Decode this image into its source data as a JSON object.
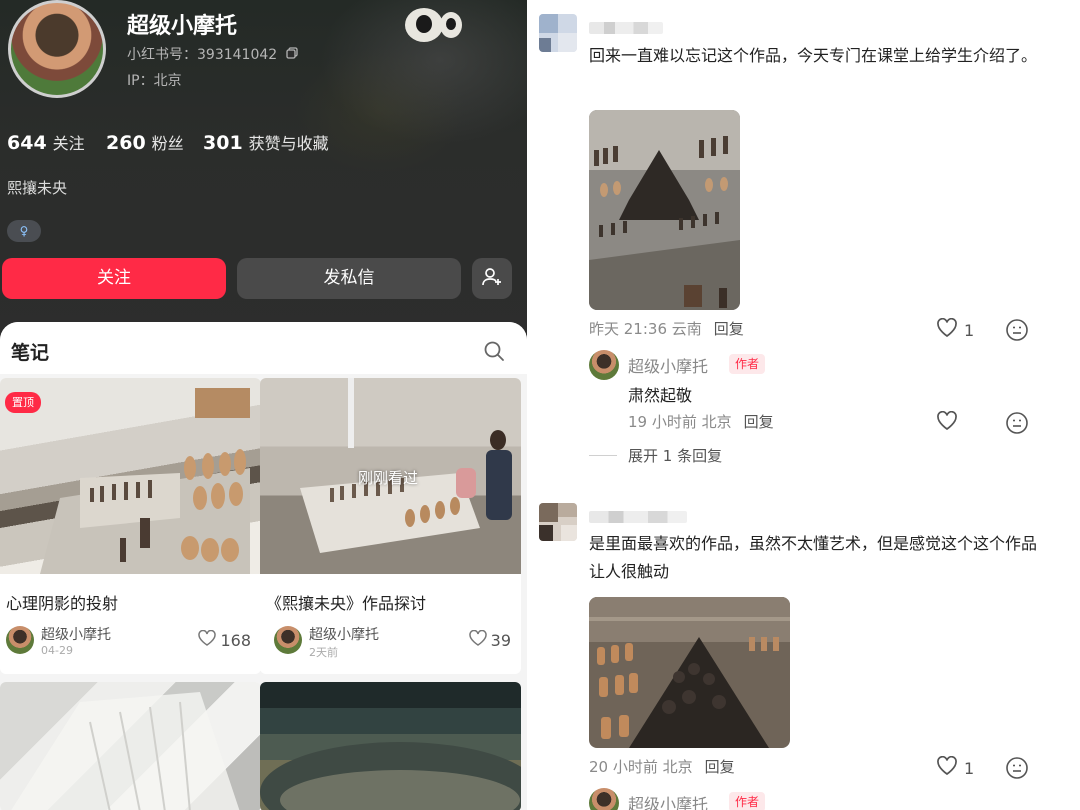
{
  "profile": {
    "name": "超级小摩托",
    "id_text": "小红书号：393141042",
    "ip_text": "IP：北京",
    "bio": "熙攘未央",
    "gender_icon": "female-symbol-icon",
    "stats": [
      {
        "count": "644",
        "label": "关注"
      },
      {
        "count": "260",
        "label": "粉丝"
      },
      {
        "count": "301",
        "label": "获赞与收藏"
      }
    ],
    "follow_label": "关注",
    "message_label": "发私信"
  },
  "notes": {
    "title": "笔记",
    "cards": [
      {
        "title": "心理阴影的投射",
        "author": "超级小摩托",
        "date": "04-29",
        "likes": "168",
        "badge": "置顶"
      },
      {
        "title": "《熙攘未央》作品探讨",
        "author": "超级小摩托",
        "date": "2天前",
        "likes": "39",
        "overlay": "刚刚看过"
      },
      {
        "title": "",
        "author": "",
        "date": "",
        "likes": ""
      },
      {
        "title": "",
        "author": "",
        "date": "",
        "likes": ""
      }
    ]
  },
  "comments": [
    {
      "text": "回来一直难以忘记这个作品，今天专门在课堂上给学生介绍了。",
      "time": "昨天 21:36 云南",
      "reply_label": "回复",
      "likes": "1",
      "replies": [
        {
          "name": "超级小摩托",
          "badge": "作者",
          "text": "肃然起敬",
          "time": "19 小时前 北京",
          "reply_label": "回复"
        }
      ],
      "expand_label": "展开 1 条回复"
    },
    {
      "text": "是里面最喜欢的作品，虽然不太懂艺术，但是感觉这个这个作品让人很触动",
      "time": "20 小时前 北京",
      "reply_label": "回复",
      "likes": "1",
      "replies": [
        {
          "name": "超级小摩托",
          "badge": "作者"
        }
      ]
    }
  ],
  "colors": {
    "accent": "#ff2a46",
    "dark_bg": "#2d2d2d"
  }
}
